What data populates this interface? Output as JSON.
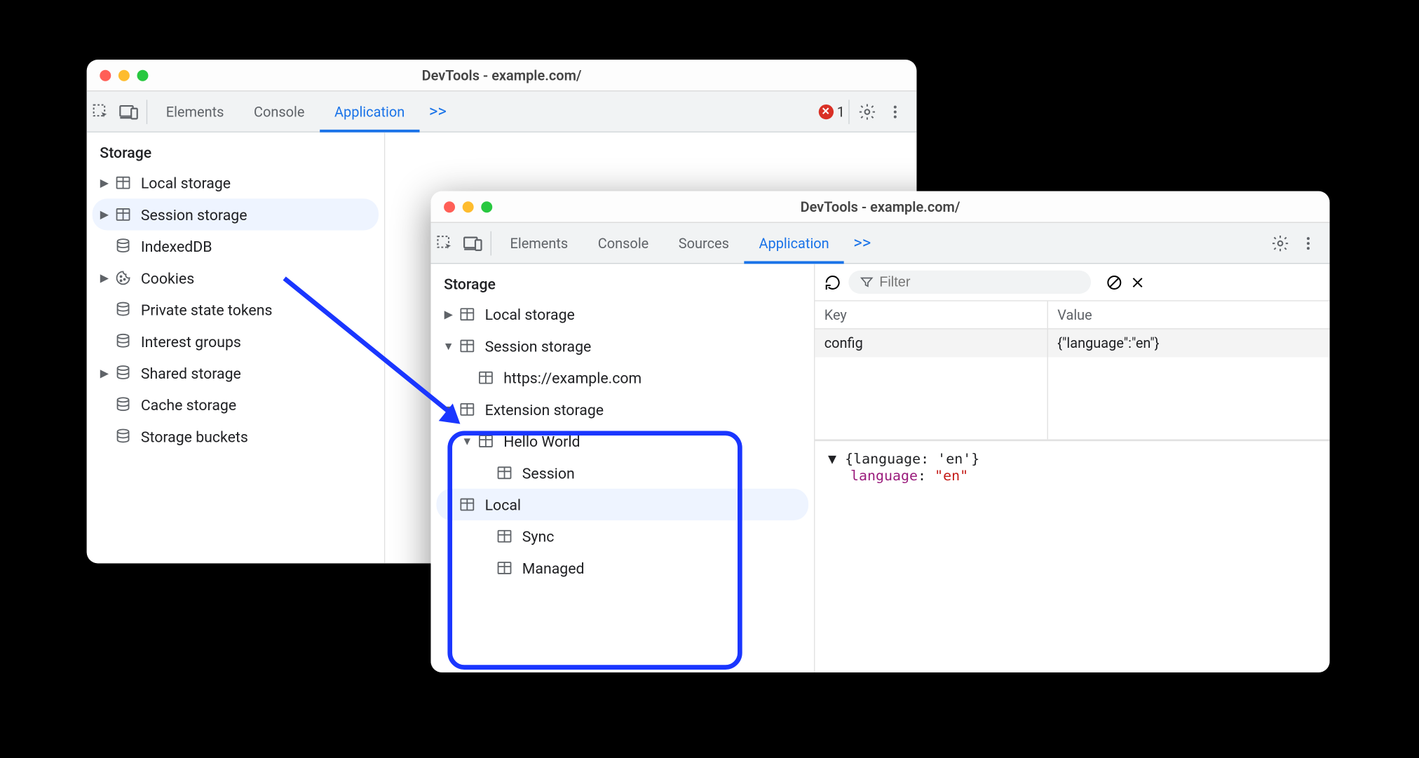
{
  "windowA": {
    "title": "DevTools - example.com/",
    "tabs": [
      "Elements",
      "Console",
      "Application"
    ],
    "active_tab": "Application",
    "more_glyph": ">>",
    "error_count": "1",
    "sidebar": {
      "section": "Storage",
      "items": [
        {
          "label": "Local storage",
          "icon": "table",
          "arrow": "right",
          "indent": 0
        },
        {
          "label": "Session storage",
          "icon": "table",
          "arrow": "right",
          "indent": 0,
          "selected": true
        },
        {
          "label": "IndexedDB",
          "icon": "db",
          "arrow": "blank",
          "indent": 0
        },
        {
          "label": "Cookies",
          "icon": "cookie",
          "arrow": "right",
          "indent": 0
        },
        {
          "label": "Private state tokens",
          "icon": "db",
          "arrow": "blank",
          "indent": 0
        },
        {
          "label": "Interest groups",
          "icon": "db",
          "arrow": "blank",
          "indent": 0
        },
        {
          "label": "Shared storage",
          "icon": "db",
          "arrow": "right",
          "indent": 0
        },
        {
          "label": "Cache storage",
          "icon": "db",
          "arrow": "blank",
          "indent": 0
        },
        {
          "label": "Storage buckets",
          "icon": "db",
          "arrow": "blank",
          "indent": 0
        }
      ]
    }
  },
  "windowB": {
    "title": "DevTools - example.com/",
    "tabs": [
      "Elements",
      "Console",
      "Sources",
      "Application"
    ],
    "active_tab": "Application",
    "more_glyph": ">>",
    "sidebar": {
      "section": "Storage",
      "items": [
        {
          "label": "Local storage",
          "icon": "table",
          "arrow": "right",
          "indent": 0
        },
        {
          "label": "Session storage",
          "icon": "table",
          "arrow": "down",
          "indent": 0
        },
        {
          "label": "https://example.com",
          "icon": "table",
          "arrow": "blank",
          "indent": 1
        },
        {
          "label": "Extension storage",
          "icon": "table",
          "arrow": "down",
          "indent": 0
        },
        {
          "label": "Hello World",
          "icon": "table",
          "arrow": "down",
          "indent": 1
        },
        {
          "label": "Session",
          "icon": "table",
          "arrow": "blank",
          "indent": 2
        },
        {
          "label": "Local",
          "icon": "table",
          "arrow": "blank",
          "indent": 2,
          "selected": true
        },
        {
          "label": "Sync",
          "icon": "table",
          "arrow": "blank",
          "indent": 2
        },
        {
          "label": "Managed",
          "icon": "table",
          "arrow": "blank",
          "indent": 2
        }
      ]
    },
    "detail": {
      "filter_placeholder": "Filter",
      "columns": [
        "Key",
        "Value"
      ],
      "rows": [
        {
          "key": "config",
          "value": "{\"language\":\"en\"}"
        }
      ],
      "inspector_summary": "{language: 'en'}",
      "inspector_key": "language",
      "inspector_val": "\"en\""
    }
  }
}
